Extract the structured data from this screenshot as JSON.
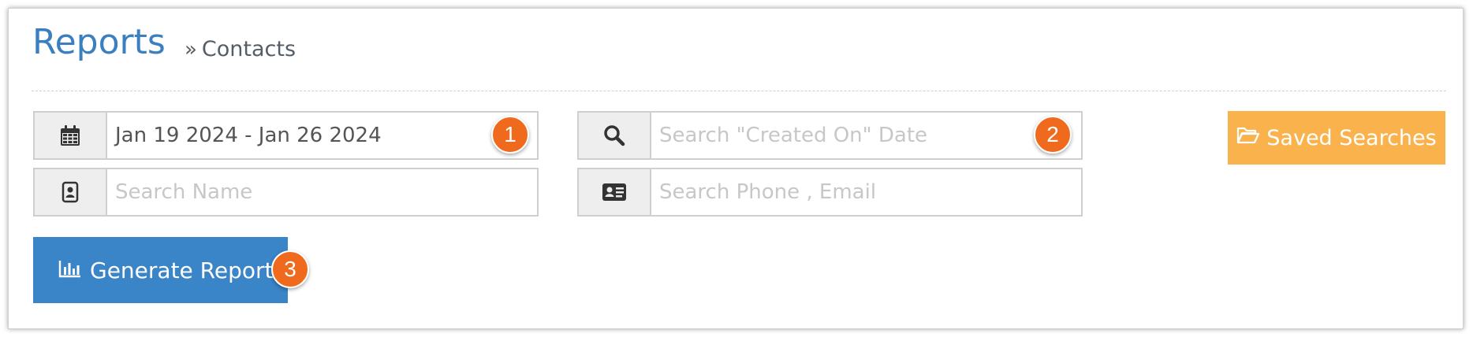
{
  "header": {
    "title": "Reports",
    "breadcrumb_separator": "»",
    "breadcrumb_current": "Contacts"
  },
  "filters": {
    "date_range": {
      "value": "Jan 19 2024 - Jan 26 2024",
      "icon": "calendar-icon"
    },
    "created_on": {
      "placeholder": "Search \"Created On\" Date",
      "icon": "search-icon"
    },
    "name": {
      "placeholder": "Search Name",
      "icon": "contact-card-icon"
    },
    "phone_email": {
      "placeholder": "Search Phone , Email",
      "icon": "id-card-icon"
    }
  },
  "actions": {
    "saved_searches_label": "Saved Searches",
    "saved_searches_icon": "folder-open-icon",
    "generate_report_label": "Generate Report",
    "generate_report_icon": "bar-chart-icon"
  },
  "badges": {
    "one": "1",
    "two": "2",
    "three": "3"
  },
  "colors": {
    "title": "#3a7fc0",
    "saved_searches_bg": "#f9b24c",
    "generate_report_bg": "#3a84c8",
    "badge_bg": "#ef6a1c"
  }
}
